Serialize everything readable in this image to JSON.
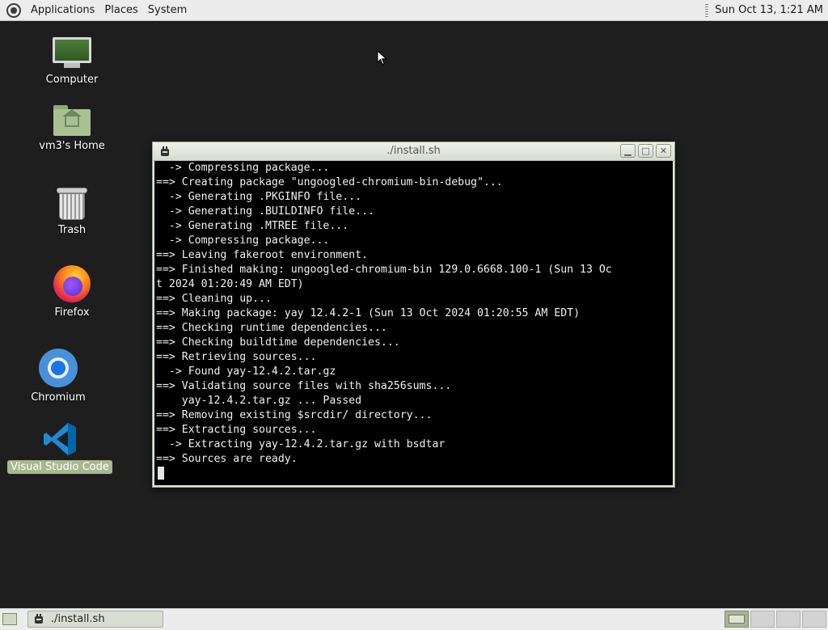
{
  "top_panel": {
    "menus": [
      "Applications",
      "Places",
      "System"
    ],
    "clock": "Sun Oct 13,  1:21 AM"
  },
  "desktop": {
    "icons": [
      {
        "label": "Computer",
        "icon": "computer-icon"
      },
      {
        "label": "vm3's Home",
        "icon": "home-folder-icon"
      },
      {
        "label": "Trash",
        "icon": "trash-icon"
      },
      {
        "label": "Firefox",
        "icon": "firefox-icon"
      },
      {
        "label": "Chromium",
        "icon": "chromium-icon"
      },
      {
        "label": "Visual Studio Code",
        "icon": "vscode-icon",
        "selected": true
      }
    ]
  },
  "terminal": {
    "title": "./install.sh",
    "lines": [
      "  -> Compressing package...",
      "==> Creating package \"ungoogled-chromium-bin-debug\"...",
      "  -> Generating .PKGINFO file...",
      "  -> Generating .BUILDINFO file...",
      "  -> Generating .MTREE file...",
      "  -> Compressing package...",
      "==> Leaving fakeroot environment.",
      "==> Finished making: ungoogled-chromium-bin 129.0.6668.100-1 (Sun 13 Oc",
      "t 2024 01:20:49 AM EDT)",
      "==> Cleaning up...",
      "==> Making package: yay 12.4.2-1 (Sun 13 Oct 2024 01:20:55 AM EDT)",
      "==> Checking runtime dependencies...",
      "==> Checking buildtime dependencies...",
      "==> Retrieving sources...",
      "  -> Found yay-12.4.2.tar.gz",
      "==> Validating source files with sha256sums...",
      "    yay-12.4.2.tar.gz ... Passed",
      "==> Removing existing $srcdir/ directory...",
      "==> Extracting sources...",
      "  -> Extracting yay-12.4.2.tar.gz with bsdtar",
      "==> Sources are ready."
    ]
  },
  "taskbar": {
    "task_label": "./install.sh",
    "workspaces": 4,
    "active_workspace": 1
  }
}
